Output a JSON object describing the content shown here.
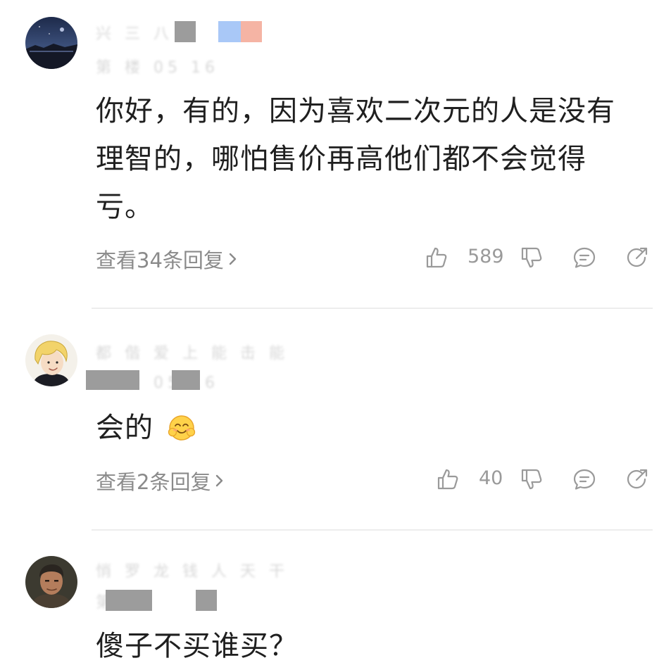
{
  "comments": [
    {
      "text": "你好，有的，因为喜欢二次元的人是没有理智的，哪怕售价再高他们都不会觉得亏。",
      "line1": "你好，有的，因为喜欢二次元的人是没有",
      "line2": "理智的，哪怕售价再高他们都不会觉得",
      "line3": "亏。",
      "view_replies": "查看34条回复",
      "likes": "589",
      "avatar_icon": "night-scene-avatar"
    },
    {
      "text": "会的",
      "view_replies": "查看2条回复",
      "likes": "40",
      "avatar_icon": "blonde-character-avatar",
      "emoji_icon": "smiling-face-emoji"
    },
    {
      "text": "傻子不买谁买？",
      "avatar_icon": "man-portrait-avatar"
    }
  ],
  "colors": {
    "text": "#1f1f1f",
    "muted": "#8a8a8a",
    "icon": "#9a9a9a",
    "divider": "#ededed",
    "mosaic_blue": "#a9c8f7",
    "mosaic_pink": "#f5b4a4"
  }
}
